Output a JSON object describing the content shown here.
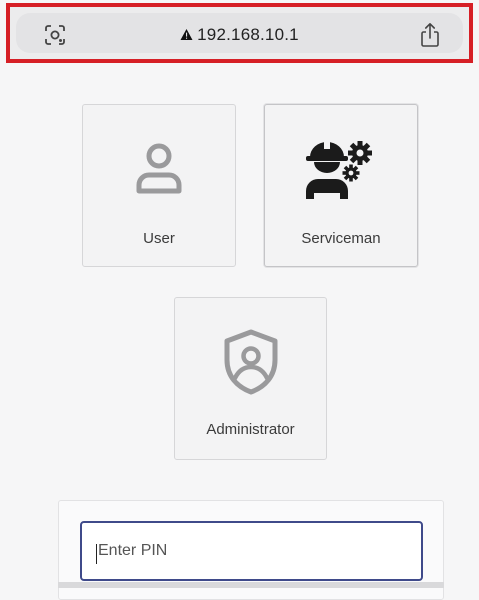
{
  "browser": {
    "url": "192.168.10.1",
    "lens_icon": "camera-lens-icon",
    "warning_icon": "warning-triangle-icon",
    "share_icon": "share-icon",
    "highlight_color": "#d61f26"
  },
  "roles": {
    "user": {
      "label": "User",
      "icon": "user-icon"
    },
    "serviceman": {
      "label": "Serviceman",
      "icon": "serviceman-icon"
    },
    "administrator": {
      "label": "Administrator",
      "icon": "admin-shield-icon"
    }
  },
  "pin": {
    "placeholder": "Enter PIN",
    "border_color": "#3f4a8a"
  }
}
